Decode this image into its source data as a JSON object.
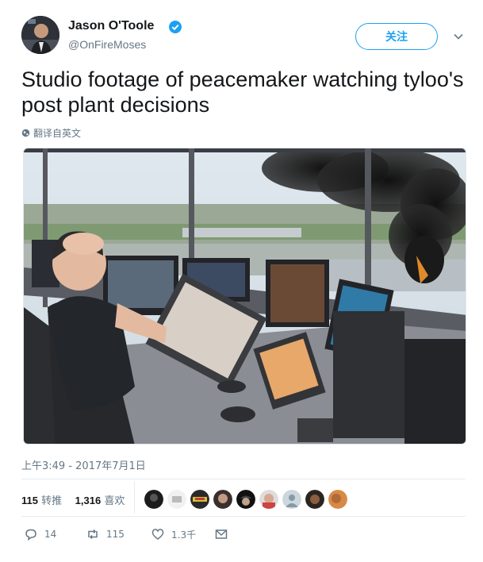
{
  "author": {
    "name": "Jason O'Toole",
    "handle": "@OnFireMoses",
    "verified": true
  },
  "follow_label": "关注",
  "tweet": {
    "text": "Studio footage of peacemaker watching tyloo's post plant decisions",
    "translate_label": "翻译自英文"
  },
  "timestamp": "上午3:49 - 2017年7月1日",
  "stats": {
    "retweets_count": "115",
    "retweets_label": "转推",
    "likes_count": "1,316",
    "likes_label": "喜欢"
  },
  "likers": [
    {
      "icon": "avatar-dark-silhouette"
    },
    {
      "icon": "avatar-light-logo"
    },
    {
      "icon": "avatar-colorful-logo"
    },
    {
      "icon": "avatar-face-dark"
    },
    {
      "icon": "avatar-dark-hat"
    },
    {
      "icon": "avatar-face-light"
    },
    {
      "icon": "avatar-default-gray"
    },
    {
      "icon": "avatar-brown-face"
    },
    {
      "icon": "avatar-orange-blur"
    }
  ],
  "actions": {
    "reply_count": "14",
    "retweet_count": "115",
    "like_count": "1.3千"
  },
  "colors": {
    "accent": "#1da1f2",
    "muted": "#657786",
    "text": "#14171a"
  }
}
